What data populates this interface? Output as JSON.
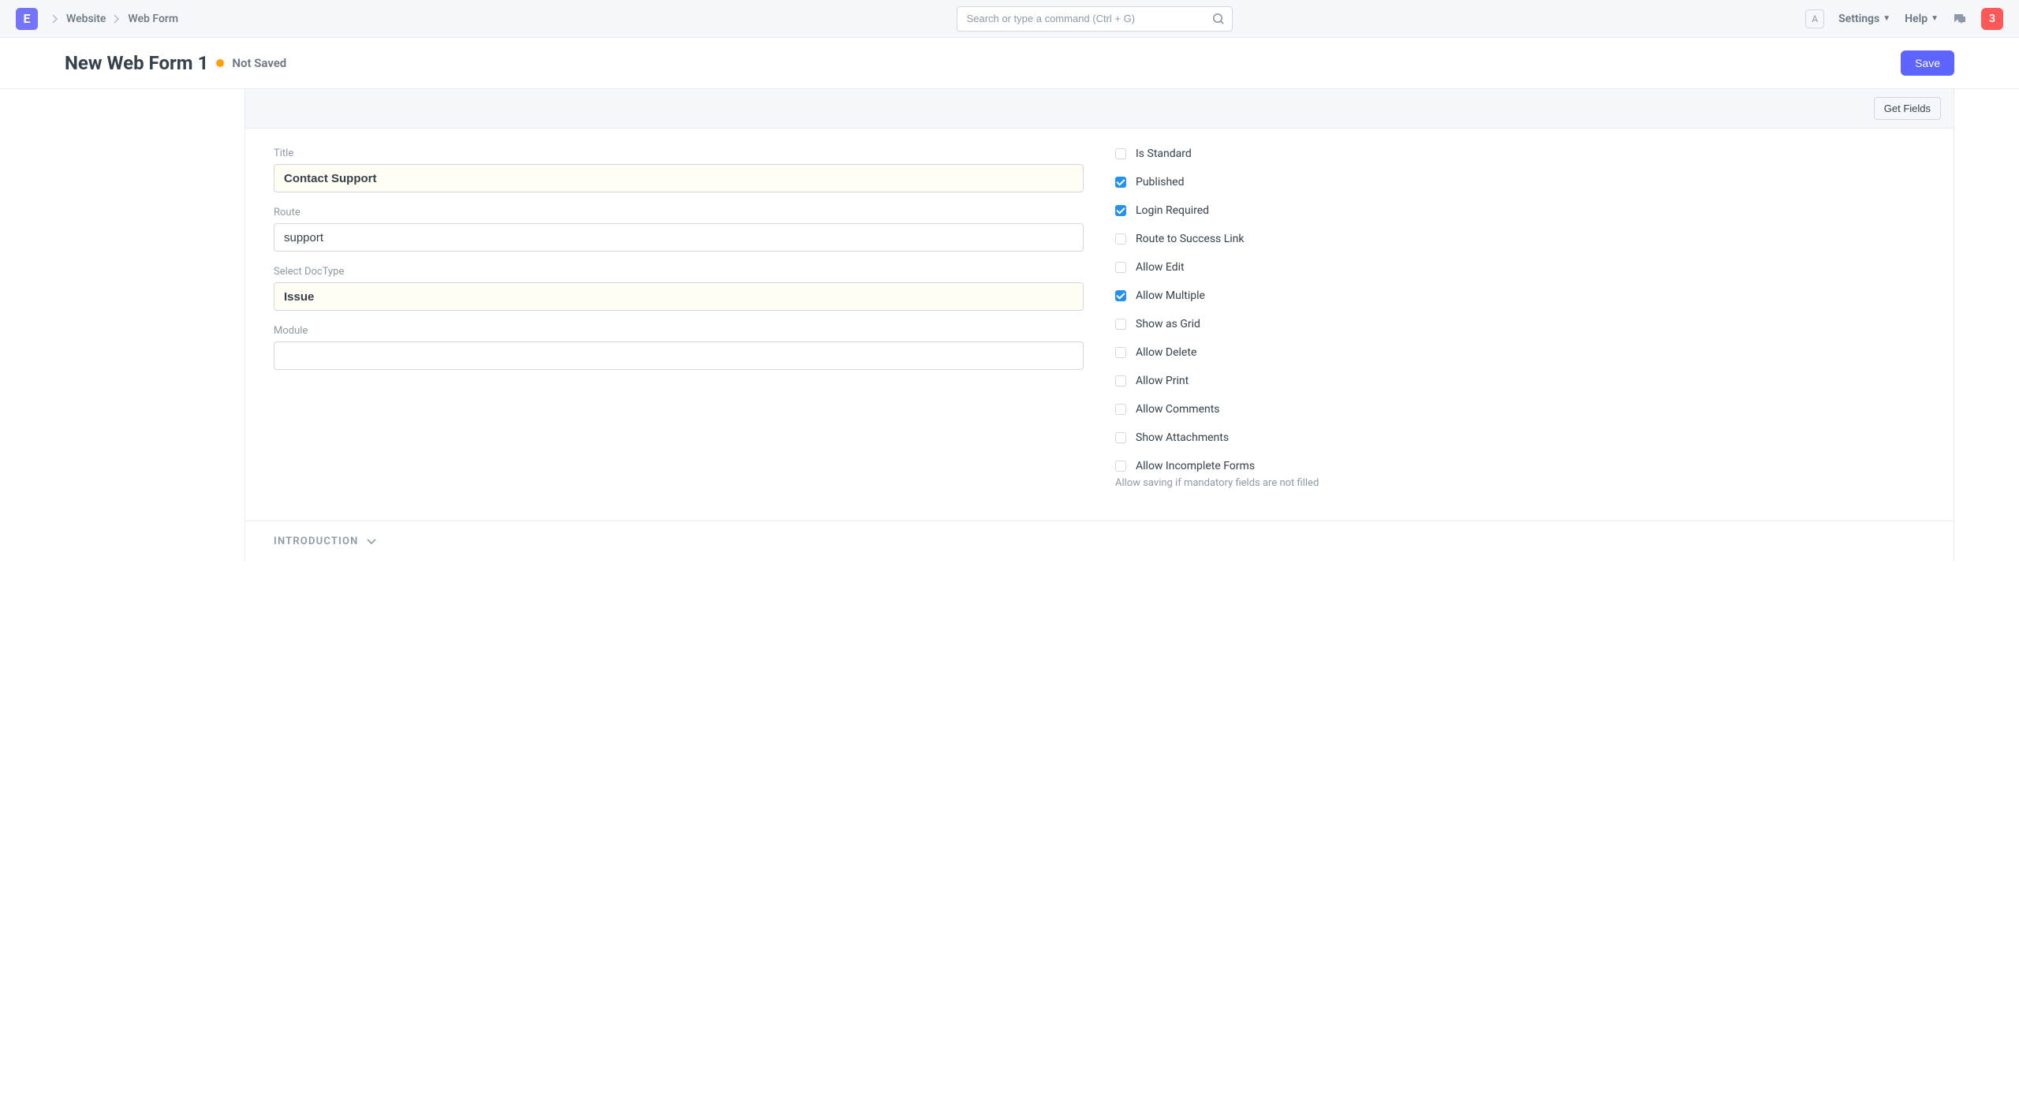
{
  "nav": {
    "logo_letter": "E",
    "breadcrumb": [
      "Website",
      "Web Form"
    ],
    "search_placeholder": "Search or type a command (Ctrl + G)",
    "avatar_letter": "A",
    "settings_label": "Settings",
    "help_label": "Help",
    "badge_count": "3"
  },
  "page": {
    "title": "New Web Form 1",
    "status_text": "Not Saved",
    "save_label": "Save"
  },
  "toolbar": {
    "get_fields_label": "Get Fields"
  },
  "form": {
    "left": {
      "title_label": "Title",
      "title_value": "Contact Support",
      "route_label": "Route",
      "route_value": "support",
      "doctype_label": "Select DocType",
      "doctype_value": "Issue",
      "module_label": "Module",
      "module_value": ""
    },
    "right": {
      "checks": [
        {
          "label": "Is Standard",
          "checked": false
        },
        {
          "label": "Published",
          "checked": true
        },
        {
          "label": "Login Required",
          "checked": true
        },
        {
          "label": "Route to Success Link",
          "checked": false
        },
        {
          "label": "Allow Edit",
          "checked": false
        },
        {
          "label": "Allow Multiple",
          "checked": true
        },
        {
          "label": "Show as Grid",
          "checked": false
        },
        {
          "label": "Allow Delete",
          "checked": false
        },
        {
          "label": "Allow Print",
          "checked": false
        },
        {
          "label": "Allow Comments",
          "checked": false
        },
        {
          "label": "Show Attachments",
          "checked": false
        },
        {
          "label": "Allow Incomplete Forms",
          "checked": false
        }
      ],
      "incomplete_help": "Allow saving if mandatory fields are not filled"
    }
  },
  "sections": {
    "introduction_label": "Introduction"
  }
}
